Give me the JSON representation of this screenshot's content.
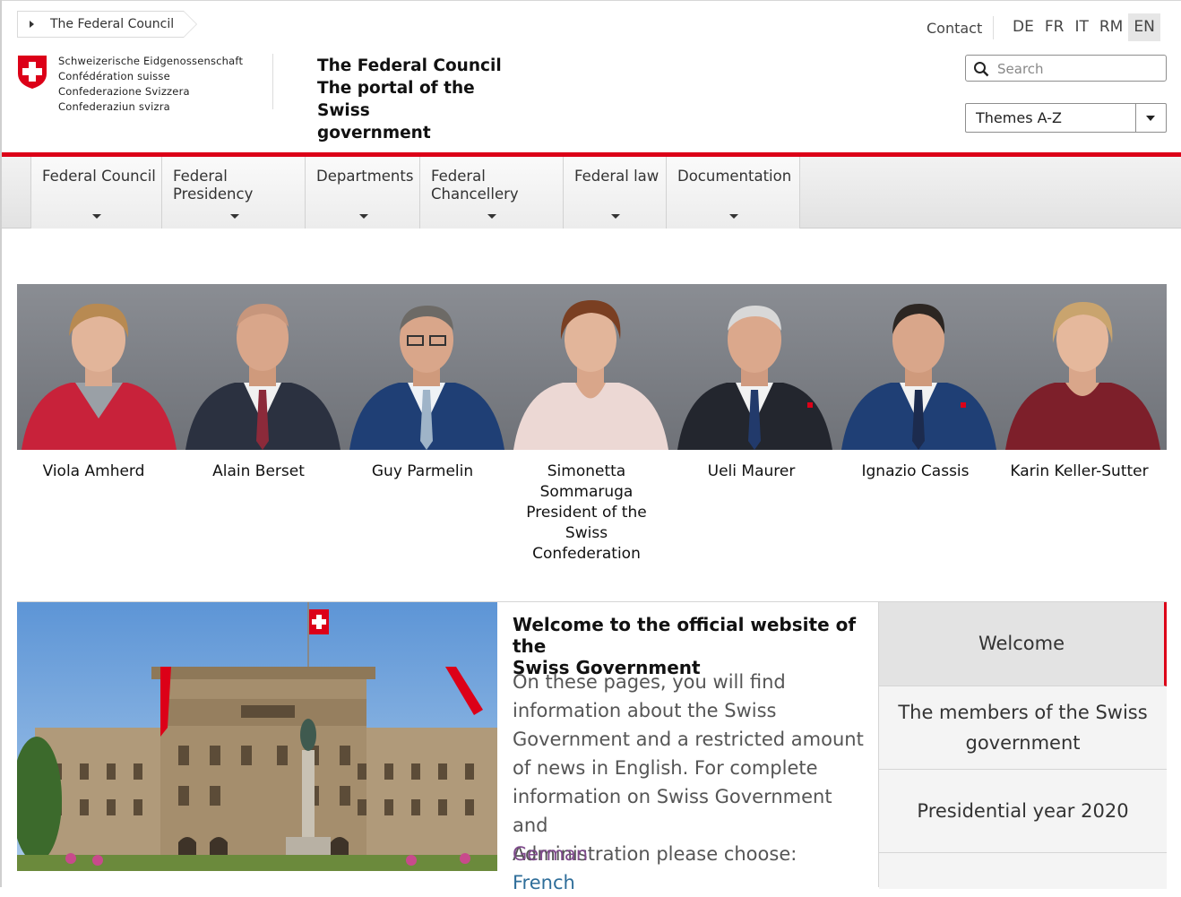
{
  "breadcrumb": {
    "label": "The Federal Council"
  },
  "logo": {
    "lines": [
      "Schweizerische Eidgenossenschaft",
      "Confédération suisse",
      "Confederazione Svizzera",
      "Confederaziun svizra"
    ]
  },
  "site": {
    "title_line1": "The Federal Council",
    "title_line2": "The portal of the Swiss",
    "title_line3": "government"
  },
  "header": {
    "contact": "Contact",
    "languages": [
      "DE",
      "FR",
      "IT",
      "RM",
      "EN"
    ],
    "active_language": "EN",
    "search_placeholder": "Search",
    "themes_label": "Themes A-Z"
  },
  "nav": {
    "items": [
      {
        "line1": "Federal Council",
        "line2": ""
      },
      {
        "line1": "Federal",
        "line2": "Presidency"
      },
      {
        "line1": "Departments",
        "line2": ""
      },
      {
        "line1": "Federal",
        "line2": "Chancellery"
      },
      {
        "line1": "Federal law",
        "line2": ""
      },
      {
        "line1": "Documentation",
        "line2": ""
      }
    ]
  },
  "members": [
    {
      "name": "Viola Amherd"
    },
    {
      "name": "Alain Berset"
    },
    {
      "name": "Guy Parmelin"
    },
    {
      "name": "Simonetta Sommaruga",
      "name_line1": "Simonetta",
      "name_line2": "Sommaruga",
      "role_line1": "President of the",
      "role_line2": "Swiss",
      "role_line3": "Confederation"
    },
    {
      "name": "Ueli Maurer"
    },
    {
      "name": "Ignazio Cassis"
    },
    {
      "name": "Karin Keller-Sutter"
    }
  ],
  "welcome": {
    "heading_line1": "Welcome to the official website of the",
    "heading_line2": "Swiss Government",
    "body_line1": "On these pages, you will find",
    "body_line2": "information about the Swiss",
    "body_line3": "Government and a restricted amount",
    "body_line4": "of news in English. For complete",
    "body_line5": "information on Swiss Government and",
    "body_line6": "Administration please choose:",
    "link_german": "German",
    "link_french": "French"
  },
  "sidenav": {
    "items": [
      {
        "line1": "Welcome",
        "line2": ""
      },
      {
        "line1": "The members of the Swiss",
        "line2": "government"
      },
      {
        "line1": "Presidential year 2020",
        "line2": ""
      }
    ],
    "active_index": 0
  },
  "colors": {
    "brand_red": "#dc0018",
    "link_visited": "#7f4a8c",
    "link": "#2f6e9a"
  }
}
